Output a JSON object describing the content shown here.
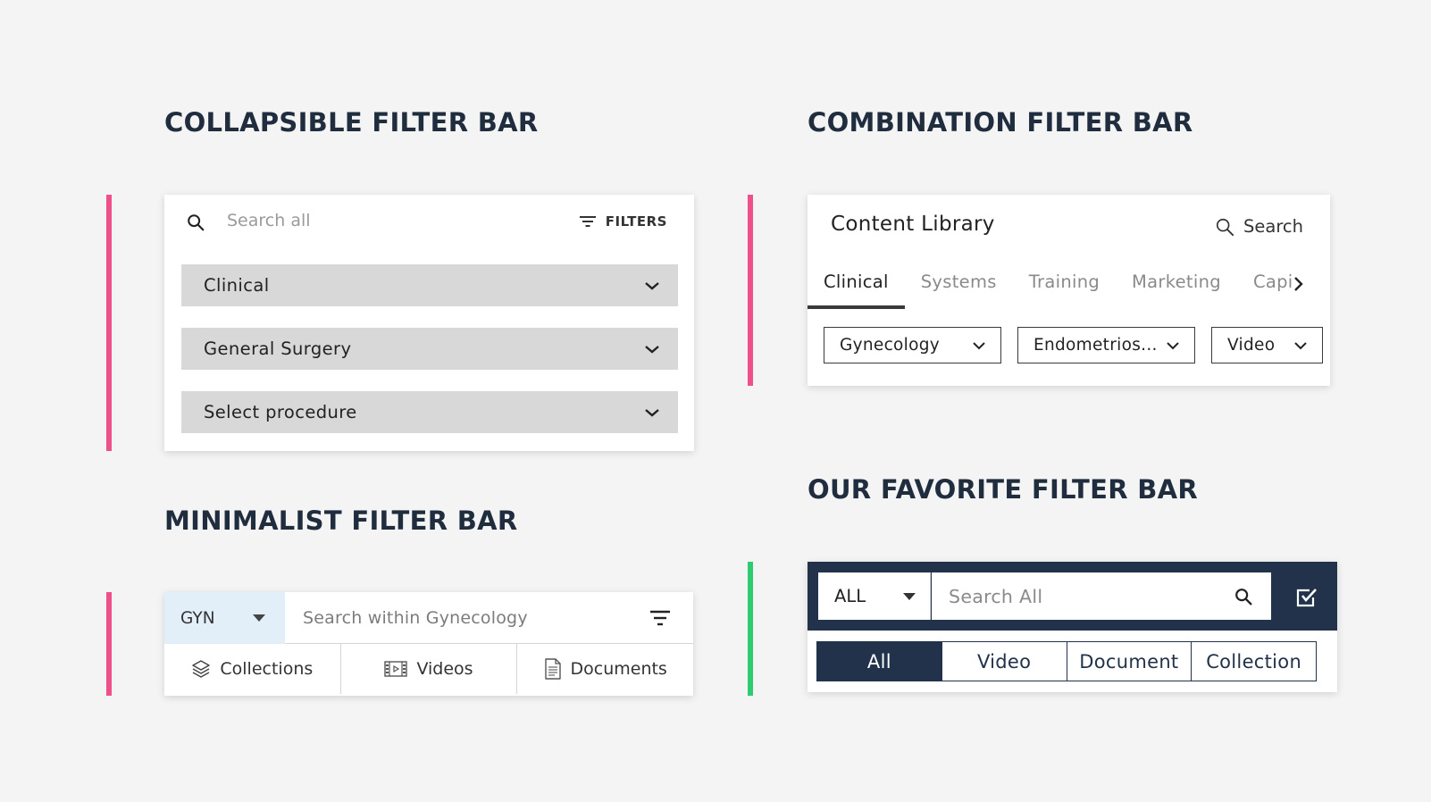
{
  "collapsible": {
    "title": "COLLAPSIBLE FILTER BAR",
    "search_placeholder": "Search all",
    "filters_label": "FILTERS",
    "dropdowns": [
      "Clinical",
      "General Surgery",
      "Select procedure"
    ]
  },
  "minimalist": {
    "title": "MINIMALIST FILTER BAR",
    "scope_value": "GYN",
    "search_placeholder": "Search within Gynecology",
    "tabs": [
      "Collections",
      "Videos",
      "Documents"
    ]
  },
  "combination": {
    "title": "COMBINATION FILTER BAR",
    "library_title": "Content Library",
    "search_label": "Search",
    "tabs": [
      "Clinical",
      "Systems",
      "Training",
      "Marketing",
      "Capi"
    ],
    "active_tab": "Clinical",
    "chips": [
      "Gynecology",
      "Endometrios...",
      "Video"
    ]
  },
  "favorite": {
    "title": "OUR FAVORITE FILTER BAR",
    "scope_value": "ALL",
    "search_placeholder": "Search All",
    "segments": [
      "All",
      "Video",
      "Document",
      "Collection"
    ],
    "active_segment": "All"
  },
  "colors": {
    "background": "#f4f4f4",
    "title": "#1f2d3f",
    "accent_pink": "#f0508a",
    "accent_green": "#2ecc71",
    "navy": "#22324a",
    "dropdown_gray": "#d8d8d8",
    "scope_blue": "#e2eef8"
  },
  "icons": {
    "search": "search-icon",
    "filters": "filter-lines-icon",
    "chevron": "chevron-down-icon",
    "caret": "caret-down-icon",
    "collections": "layers-icon",
    "videos": "film-icon",
    "documents": "document-icon",
    "check": "checkbox-checked-icon",
    "next": "chevron-right-icon"
  }
}
